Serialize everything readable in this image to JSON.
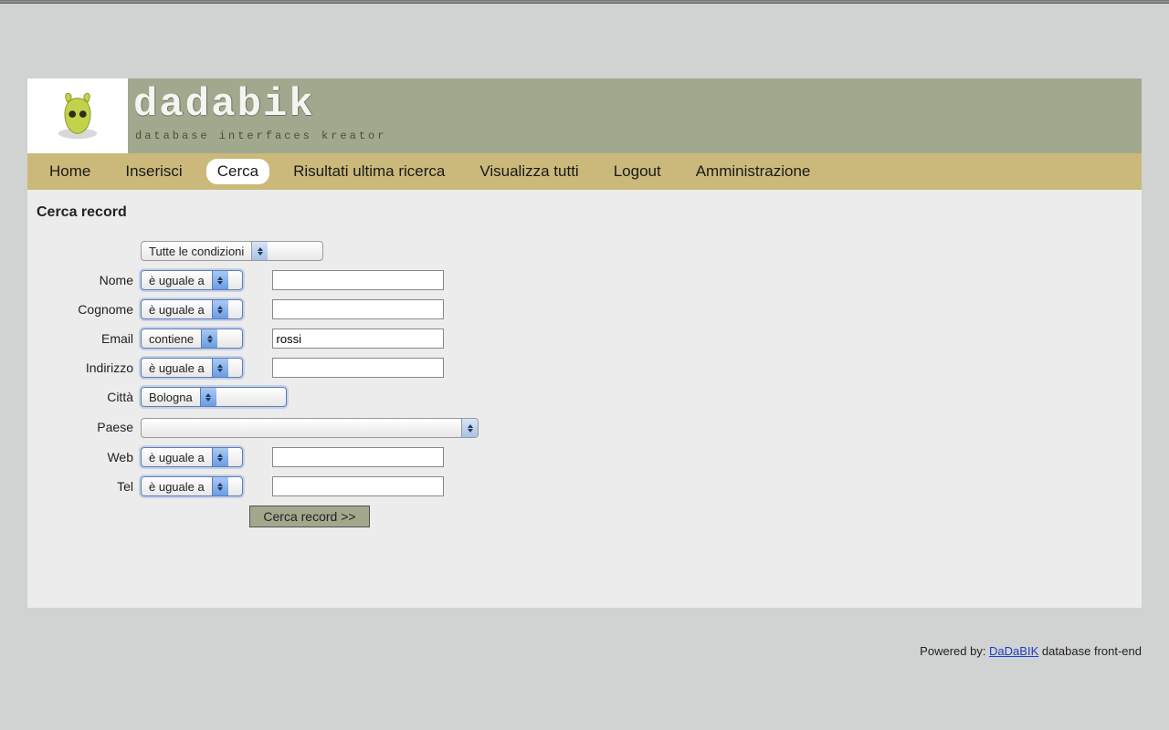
{
  "brand": {
    "name": "dadabik",
    "tagline": "database interfaces kreator"
  },
  "nav": {
    "home": "Home",
    "insert": "Inserisci",
    "search": "Cerca",
    "lastResults": "Risultati ultima ricerca",
    "showAll": "Visualizza tutti",
    "logout": "Logout",
    "admin": "Amministrazione"
  },
  "section": {
    "title": "Cerca record"
  },
  "conditions": {
    "selected": "Tutte le condizioni"
  },
  "ops": {
    "equals": "è uguale a",
    "contains": "contiene"
  },
  "fields": {
    "nome": {
      "label": "Nome",
      "op": "è uguale a",
      "value": ""
    },
    "cognome": {
      "label": "Cognome",
      "op": "è uguale a",
      "value": ""
    },
    "email": {
      "label": "Email",
      "op": "contiene",
      "value": "rossi"
    },
    "indirizzo": {
      "label": "Indirizzo",
      "op": "è uguale a",
      "value": ""
    },
    "citta": {
      "label": "Città",
      "selected": "Bologna"
    },
    "paese": {
      "label": "Paese",
      "selected": ""
    },
    "web": {
      "label": "Web",
      "op": "è uguale a",
      "value": ""
    },
    "tel": {
      "label": "Tel",
      "op": "è uguale a",
      "value": ""
    }
  },
  "buttons": {
    "submitSearch": "Cerca record >>"
  },
  "footer": {
    "prefix": "Powered by: ",
    "link": "DaDaBIK",
    "suffix": " database front-end"
  }
}
